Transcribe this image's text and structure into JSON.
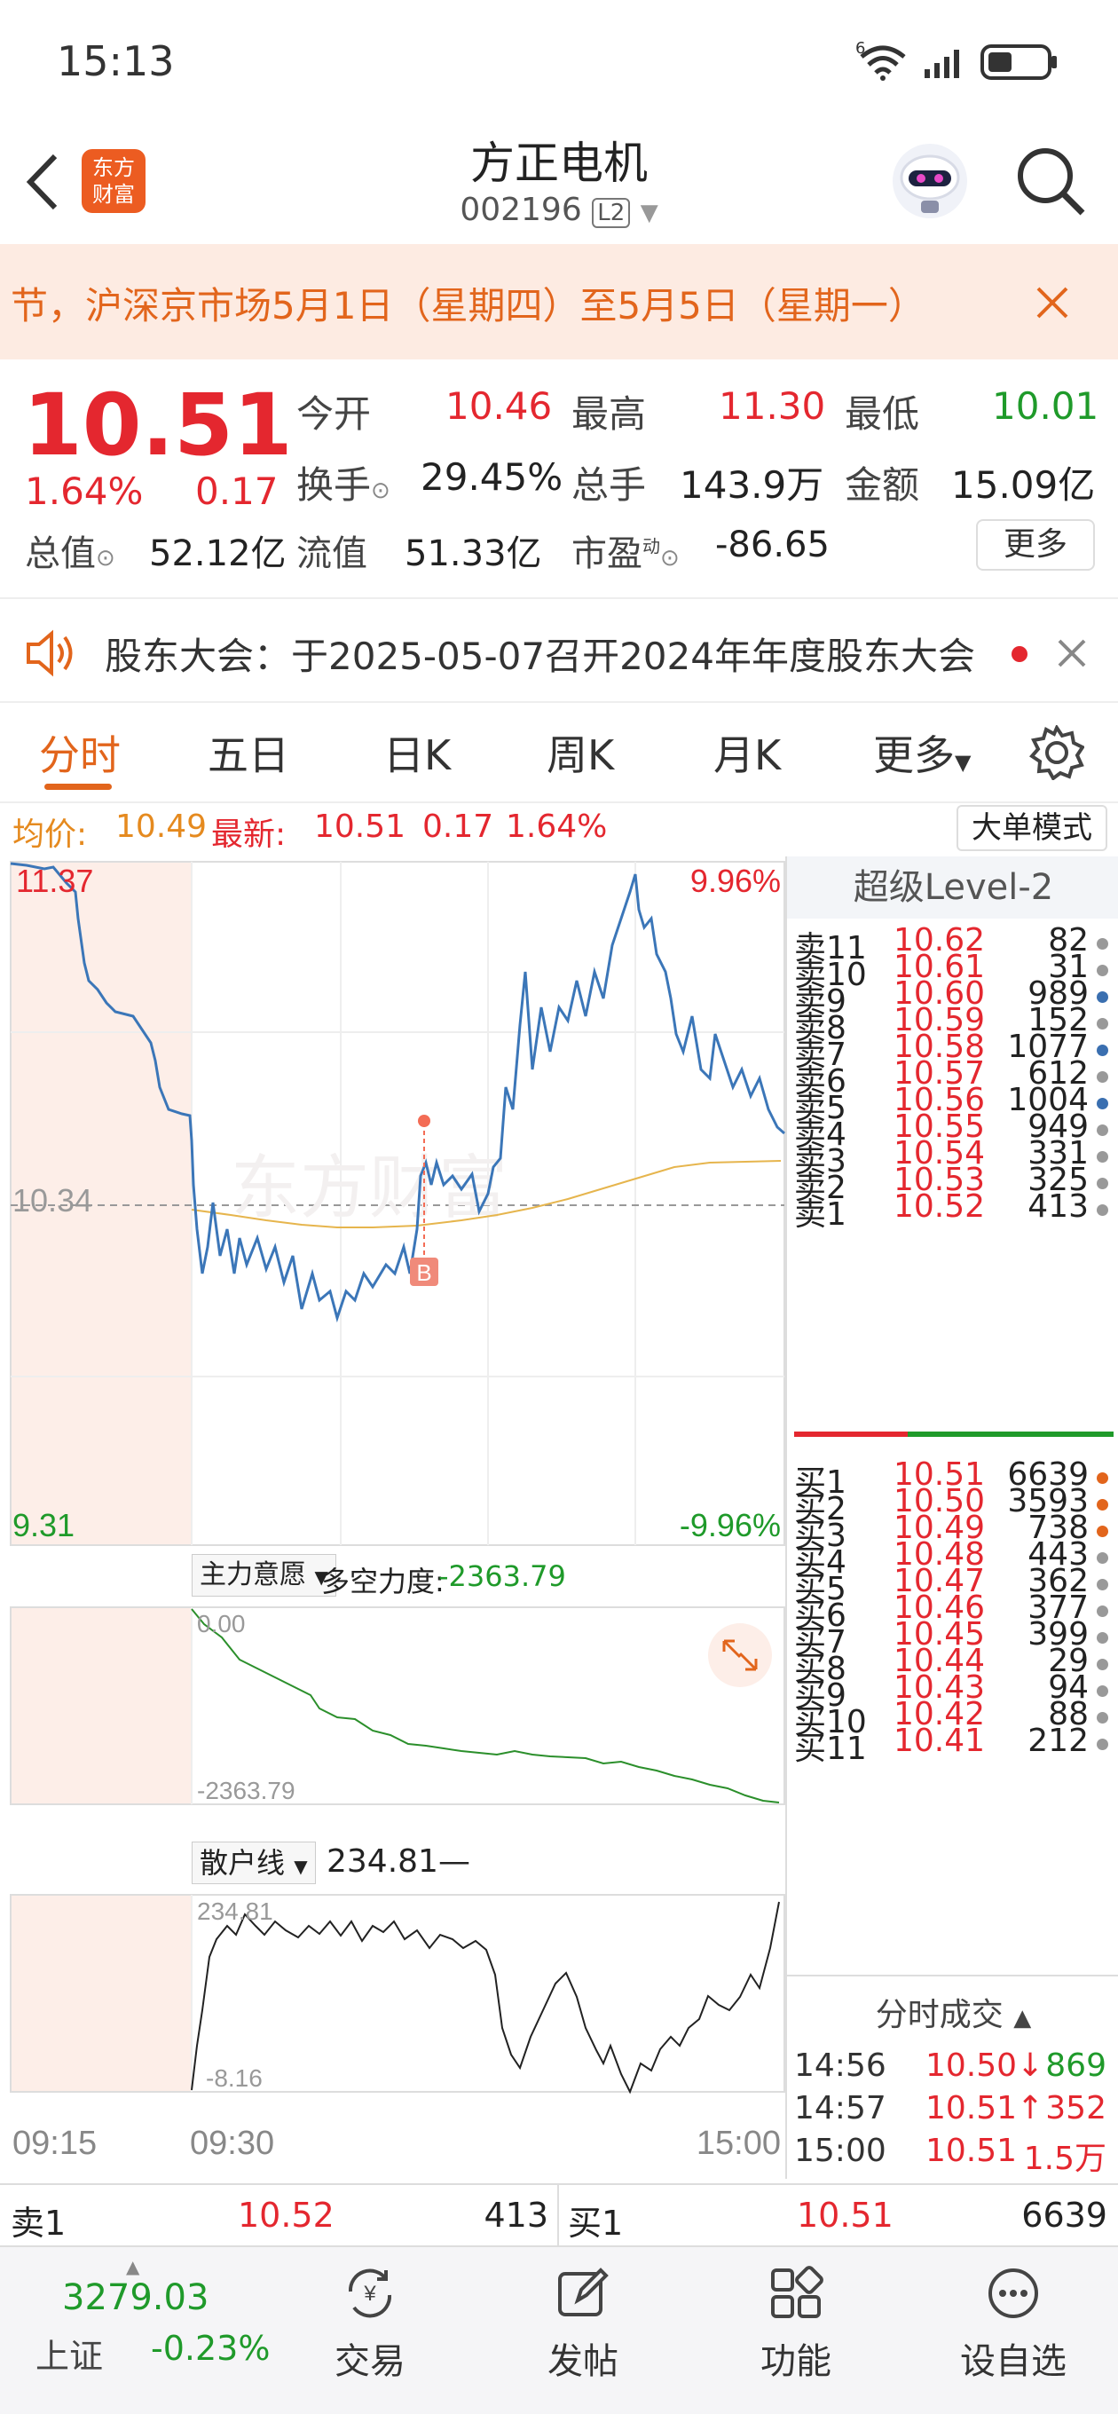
{
  "status": {
    "time": "15:13",
    "net": "6"
  },
  "nav": {
    "logo_l1": "东方",
    "logo_l2": "财富",
    "name": "方正电机",
    "code": "002196",
    "badge": "L2"
  },
  "banner": {
    "text": "节，沪深京市场5月1日（星期四）至5月5日（星期一）"
  },
  "quote": {
    "price": "10.51",
    "pct": "1.64%",
    "chg": "0.17",
    "open_label": "今开",
    "open": "10.46",
    "high_label": "最高",
    "high": "11.30",
    "low_label": "最低",
    "low": "10.01",
    "turnover_label": "换手",
    "turnover": "29.45%",
    "vol_label": "总手",
    "vol": "143.9万",
    "amt_label": "金额",
    "amt": "15.09亿",
    "mcap_label": "总值",
    "mcap": "52.12亿",
    "float_label": "流值",
    "float": "51.33亿",
    "pe_label": "市盈",
    "pe_sup": "动",
    "pe": "-86.65",
    "more": "更多"
  },
  "notice": {
    "text": "股东大会：于2025-05-07召开2024年年度股东大会"
  },
  "tabs": [
    "分时",
    "五日",
    "日K",
    "周K",
    "月K",
    "更多"
  ],
  "info": {
    "avg_label": "均价:",
    "avg": "10.49",
    "last_label": "最新:",
    "last": "10.51",
    "chg": "0.17",
    "pct": "1.64%",
    "mode": "大单模式"
  },
  "chart": {
    "hi": "11.37",
    "lo": "9.31",
    "mid": "10.34",
    "pct_hi": "9.96%",
    "pct_lo": "-9.96%",
    "watermark": "东方财富",
    "buy_mark": "B",
    "ind1_name": "主力意愿",
    "ind1_label": "多空力度:",
    "ind1_value": "-2363.79",
    "ind1_top": "0.00",
    "ind1_bottom": "-2363.79",
    "ind2_name": "散户线",
    "ind2_value": "234.81—",
    "ind2_top": "234.81",
    "ind2_bottom": "-8.16",
    "t0": "09:15",
    "t1": "09:30",
    "t2": "15:00"
  },
  "book": {
    "title": "超级Level-2",
    "asks": [
      [
        "卖11",
        "10.62",
        "82",
        "#999"
      ],
      [
        "卖10",
        "10.61",
        "31",
        "#999"
      ],
      [
        "卖9",
        "10.60",
        "989",
        "#3a6fb0"
      ],
      [
        "卖8",
        "10.59",
        "152",
        "#999"
      ],
      [
        "卖7",
        "10.58",
        "1077",
        "#3a6fb0"
      ],
      [
        "卖6",
        "10.57",
        "612",
        "#999"
      ],
      [
        "卖5",
        "10.56",
        "1004",
        "#3a6fb0"
      ],
      [
        "卖4",
        "10.55",
        "949",
        "#999"
      ],
      [
        "卖3",
        "10.54",
        "331",
        "#999"
      ],
      [
        "卖2",
        "10.53",
        "325",
        "#999"
      ],
      [
        "卖1",
        "10.52",
        "413",
        "#999"
      ]
    ],
    "bids": [
      [
        "买1",
        "10.51",
        "6639",
        "#e2651c"
      ],
      [
        "买2",
        "10.50",
        "3593",
        "#e2651c"
      ],
      [
        "买3",
        "10.49",
        "738",
        "#e2651c"
      ],
      [
        "买4",
        "10.48",
        "443",
        "#999"
      ],
      [
        "买5",
        "10.47",
        "362",
        "#999"
      ],
      [
        "买6",
        "10.46",
        "377",
        "#999"
      ],
      [
        "买7",
        "10.45",
        "399",
        "#999"
      ],
      [
        "买8",
        "10.44",
        "29",
        "#999"
      ],
      [
        "买9",
        "10.43",
        "94",
        "#999"
      ],
      [
        "买10",
        "10.42",
        "88",
        "#999"
      ],
      [
        "买11",
        "10.41",
        "212",
        "#999"
      ]
    ],
    "trade_title": "分时成交",
    "trades": [
      [
        "14:56",
        "10.50↓",
        "869",
        "#1f9a2a"
      ],
      [
        "14:57",
        "10.51↑",
        "352",
        "#e4272f"
      ],
      [
        "15:00",
        "10.51",
        "1.5万",
        "#e4272f"
      ]
    ]
  },
  "bottom": {
    "sell_label": "卖1",
    "sell_price": "10.52",
    "sell_vol": "413",
    "buy_label": "买1",
    "buy_price": "10.51",
    "buy_vol": "6639"
  },
  "footer": {
    "index_val": "3279.03",
    "index_name": "上证",
    "index_pct": "-0.23%",
    "trade": "交易",
    "post": "发帖",
    "func": "功能",
    "watch": "设自选"
  }
}
